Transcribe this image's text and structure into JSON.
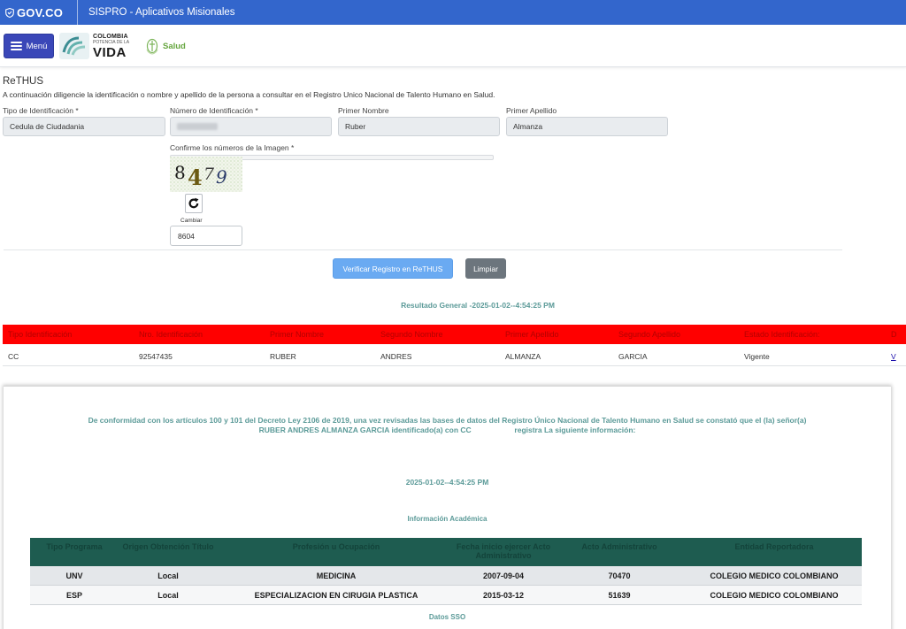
{
  "header": {
    "gov_label": "GOV.CO",
    "app_title": "SISPRO - Aplicativos Misionales"
  },
  "nav": {
    "menu_label": "Menú",
    "logo_line1": "COLOMBIA",
    "logo_line2": "POTENCIA DE LA",
    "logo_line3": "VIDA",
    "salud_label": "Salud"
  },
  "form": {
    "title": "ReTHUS",
    "description": "A continuación diligencie la identificación o nombre y apellido de la persona a consultar en el Registro Unico Nacional de Talento Humano en Salud.",
    "tipo_label": "Tipo de Identificación *",
    "tipo_value": "Cedula de Ciudadania",
    "numero_label": "Número de Identificación *",
    "nombre_label": "Primer Nombre",
    "nombre_value": "Ruber",
    "apellido_label": "Primer Apellido",
    "apellido_value": "Almanza",
    "captcha_label": "Confirme los números de la Imagen *",
    "captcha_digits": [
      "8",
      "4",
      "7",
      "9"
    ],
    "cambiar_label": "Cambiar",
    "captcha_value": "8604",
    "verify_button": "Verificar Registro en ReTHUS",
    "clear_button": "Limpiar"
  },
  "result": {
    "title": "Resultado General -2025-01-02--4:54:25 PM",
    "headers": [
      "Tipo Identificación",
      "Nro. Identificación",
      "Primer Nombre",
      "Segundo Nombre",
      "Primer Apellido",
      "Segundo Apellido",
      "Estado Identificación:",
      "D"
    ],
    "row": [
      "CC",
      "92547435",
      "RUBER",
      "ANDRES",
      "ALMANZA",
      "GARCIA",
      "Vigente",
      "V"
    ],
    "header_color": "#ff0000"
  },
  "certificate": {
    "line1": "De conformidad con los artículos 100 y 101 del Decreto Ley 2106 de 2019, una vez revisadas las bases de datos del Registro Único Nacional de Talento Humano en Salud se constató que el (la) señor(a)",
    "line2a": "RUBER ANDRES ALMANZA GARCIA identificado(a) con CC",
    "line2b": "registra La siguiente información:",
    "date": "2025-01-02--4:54:25 PM",
    "academic_title": "Información Académica",
    "academic_headers": [
      "Tipo Programa",
      "Origen Obtención Título",
      "Profesión u Ocupación",
      "Fecha inicio ejercer Acto Administrativo",
      "Acto Administrativo",
      "Entidad Reportadora"
    ],
    "academic_rows": [
      [
        "UNV",
        "Local",
        "MEDICINA",
        "2007-09-04",
        "70470",
        "COLEGIO MEDICO COLOMBIANO"
      ],
      [
        "ESP",
        "Local",
        "ESPECIALIZACION EN CIRUGIA PLASTICA",
        "2015-03-12",
        "51639",
        "COLEGIO MEDICO COLOMBIANO"
      ]
    ],
    "sso_title": "Datos SSO"
  },
  "colors": {
    "gov_blue": "#3366cc",
    "teal_text": "#5b9a98",
    "table_green": "#1e5c50"
  }
}
